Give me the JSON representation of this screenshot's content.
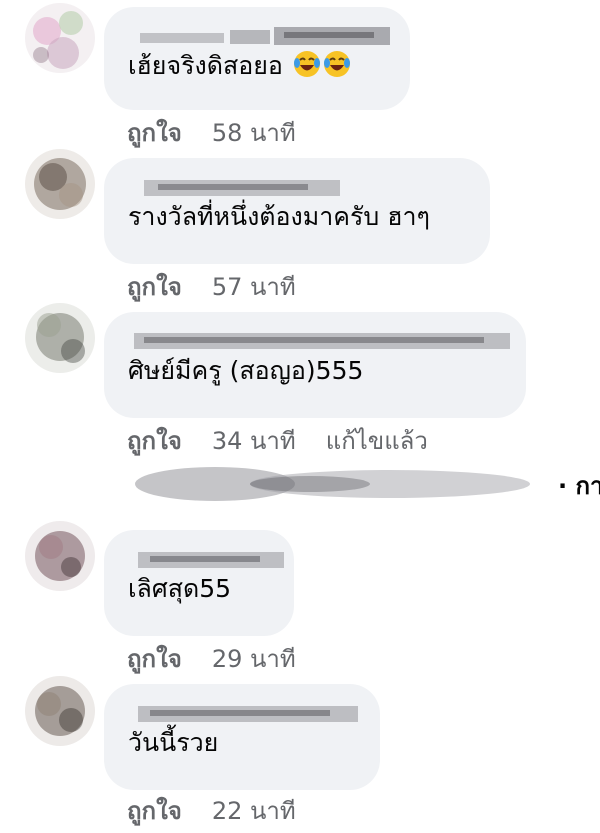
{
  "comments": [
    {
      "text": "เฮ้ยจริงดิสอยอ",
      "reaction_emoji": [
        "rolling-on-floor-laughing-emoji",
        "rolling-on-floor-laughing-emoji"
      ],
      "like_label": "ถูกใจ",
      "time": "58 นาที"
    },
    {
      "text": "รางวัลที่หนึ่งต้องมาครับ ฮาๆ",
      "like_label": "ถูกใจ",
      "time": "57 นาที"
    },
    {
      "text": "ศิษย์มีครู (สอญอ)555",
      "like_label": "ถูกใจ",
      "time": "34 นาที",
      "edited_label": "แก้ไขแล้ว"
    },
    {
      "text": "เลิศสุด55",
      "like_label": "ถูกใจ",
      "time": "29 นาที"
    },
    {
      "text": "วันนี้รวย",
      "like_label": "ถูกใจ",
      "time": "22 นาที"
    }
  ],
  "replies_row": {
    "trailing_text": "· กา"
  },
  "colors": {
    "bubble_bg": "#f0f2f5",
    "text": "#050505",
    "meta": "#65676b",
    "emoji_face": "#f7c325",
    "emoji_tear": "#3b9be8"
  }
}
